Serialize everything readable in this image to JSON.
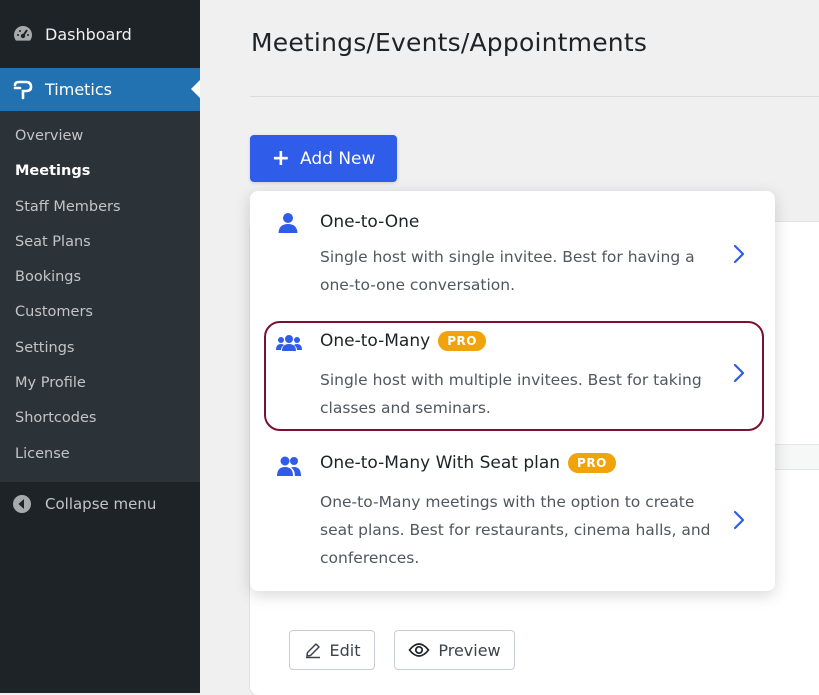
{
  "sidebar": {
    "dashboard_label": "Dashboard",
    "plugin_label": "Timetics",
    "items": [
      {
        "label": "Overview"
      },
      {
        "label": "Meetings"
      },
      {
        "label": "Staff Members"
      },
      {
        "label": "Seat Plans"
      },
      {
        "label": "Bookings"
      },
      {
        "label": "Customers"
      },
      {
        "label": "Settings"
      },
      {
        "label": "My Profile"
      },
      {
        "label": "Shortcodes"
      },
      {
        "label": "License"
      }
    ],
    "collapse_label": "Collapse menu"
  },
  "main": {
    "title": "Meetings/Events/Appointments",
    "add_new_label": "Add New",
    "edit_label": "Edit",
    "preview_label": "Preview"
  },
  "dropdown": {
    "options": [
      {
        "title": "One-to-One",
        "desc_line1": "Single host with single invitee. Best for having a",
        "desc_line2": "one-to-one conversation.",
        "badge": ""
      },
      {
        "title": "One-to-Many",
        "desc_line1": "Single host with multiple invitees. Best for taking",
        "desc_line2": "classes and seminars.",
        "badge": "PRO"
      },
      {
        "title": "One-to-Many With Seat plan",
        "desc_line1": "One-to-Many meetings with the option to create",
        "desc_line2": "seat plans. Best for restaurants, cinema halls, and",
        "desc_line3": "conferences.",
        "badge": "PRO"
      }
    ]
  },
  "colors": {
    "accent_blue": "#2f5ce8",
    "icon_blue": "#2f5ce8",
    "pro_badge": "#f0a30a",
    "highlight_border": "#7b1130",
    "wp_active": "#2271b1"
  }
}
